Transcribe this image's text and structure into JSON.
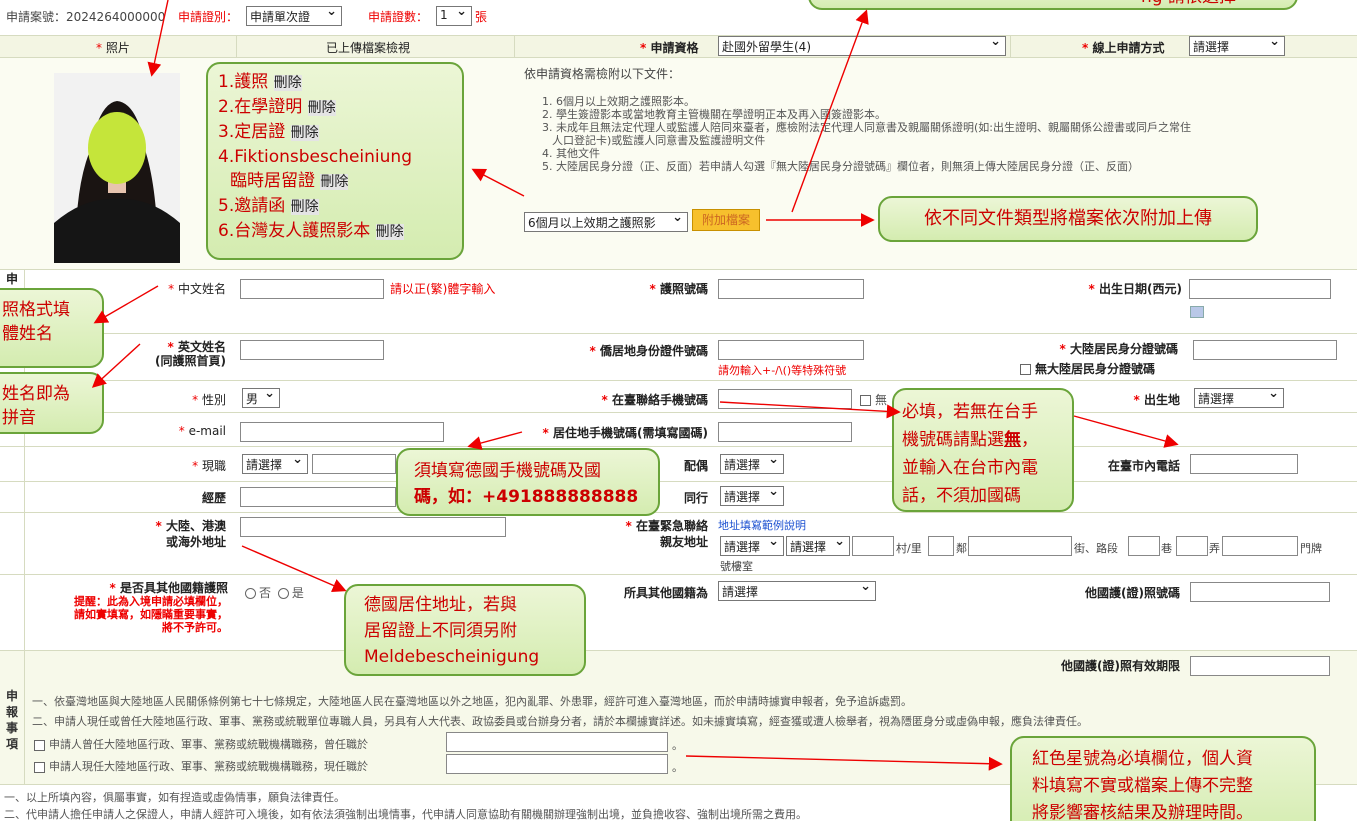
{
  "top": {
    "case_label": "申請案號：",
    "case_no": "2024264000000",
    "cert_type_label": "申請證別：",
    "cert_type_value": "申請單次證",
    "cert_count_label": "申請證數：",
    "cert_count_value": "1",
    "cert_count_unit": "張"
  },
  "header": {
    "photo": "照片",
    "uploaded": "已上傳檔案檢視",
    "qualification": "申請資格",
    "qualification_value": "赴國外留學生(4)",
    "apply_method": "線上申請方式",
    "apply_method_value": "請選擇"
  },
  "docs": {
    "intro": "依申請資格需檢附以下文件：",
    "items": [
      "1. 6個月以上效期之護照影本。",
      "2. 學生簽證影本或當地教育主管機關在學證明正本及再入國簽證影本。",
      "3. 未成年且無法定代理人或監護人陪同來臺者，應檢附法定代理人同意書及親屬關係證明(如:出生證明、親屬關係公證書或同戶之常住",
      "人口登記卡)或監護人同意書及監護證明文件",
      "4. 其他文件",
      "5. 大陸居民身分證（正、反面）若申請人勾選『無大陸居民身分證號碼』欄位者，則無須上傳大陸居民身分證（正、反面）"
    ],
    "select_value": "6個月以上效期之護照影",
    "attach_button": "附加檔案"
  },
  "uploads": [
    {
      "name": "1.護照",
      "del": "刪除"
    },
    {
      "name": "2.在學證明",
      "del": "刪除"
    },
    {
      "name": "3.定居證",
      "del": "刪除"
    },
    {
      "name": "4.Fiktionsbescheiniung",
      "del": ""
    },
    {
      "name": "臨時居留證",
      "del": "刪除"
    },
    {
      "name": "5.邀請函",
      "del": "刪除"
    },
    {
      "name": "6.台灣友人護照影本",
      "del": "刪除"
    }
  ],
  "form": {
    "cn_name": "中文姓名",
    "cn_name_hint": "請以正(繁)體字輸入",
    "passport_no": "護照號碼",
    "birth": "出生日期(西元)",
    "en_name": "英文姓名",
    "en_name_sub": "(同護照首頁)",
    "residence_id": "僑居地身份證件號碼",
    "residence_id_hint": "請勿輸入+-/\\()等特殊符號",
    "mainland_id": "大陸居民身分證號碼",
    "no_mainland_id": "無大陸居民身分證號碼",
    "gender": "性別",
    "gender_value": "男",
    "tw_mobile": "在臺聯絡手機號碼",
    "tw_mobile_none": "無",
    "birthplace": "出生地",
    "birthplace_value": "請選擇",
    "email": "e-mail",
    "res_mobile": "居住地手機號碼(需填寫國碼)",
    "job": "現職",
    "job_value": "請選擇",
    "spouse": "配偶",
    "spouse_value": "請選擇",
    "tw_phone": "在臺市內電話",
    "experience": "經歷",
    "accompany": "同行",
    "accompany_value": "請選擇",
    "address": "大陸、港澳",
    "address2": "或海外地址",
    "emergency": "在臺緊急聯絡",
    "emergency2": "親友地址",
    "addr_example": "地址填寫範例說明",
    "addr_sel1": "請選擇",
    "addr_sel2": "請選擇",
    "addr_village": "村/里",
    "addr_lin": "鄰",
    "addr_street": "街、路段",
    "addr_lane": "巷",
    "addr_alley": "弄",
    "addr_no": "門牌",
    "addr_floor": "號樓室",
    "other_passport": "是否具其他國籍護照",
    "other_passport_note1": "提醒：此為入境申請必填欄位，",
    "other_passport_note2": "請如實填寫，如隱瞞重要事實，",
    "other_passport_note3": "將不予許可。",
    "no": "否",
    "yes": "是",
    "other_nationality": "所具其他國籍為",
    "other_nationality_value": "請選擇",
    "other_passport_no": "他國護(證)照號碼",
    "other_passport_exp": "他國護(證)照有效期限"
  },
  "declare": {
    "title": "申報事項",
    "line1": "一、依臺灣地區與大陸地區人民關係條例第七十七條規定，大陸地區人民在臺灣地區以外之地區，犯內亂罪、外患罪，經許可進入臺灣地區，而於申請時據實申報者，免予追訴處罰。",
    "line2": "二、申請人現任或曾任大陸地區行政、軍事、黨務或統戰單位專職人員，另具有人大代表、政協委員或台辦身分者，請於本欄據實詳述。如未據實填寫，經查獲或遭人檢舉者，視為隱匿身分或虛偽申報，應負法律責任。",
    "chk1": "申請人曾任大陸地區行政、軍事、黨務或統戰機構職務，曾任職於",
    "chk2": "申請人現任大陸地區行政、軍事、黨務或統戰機構職務，現任職於"
  },
  "footer": {
    "line1": "一、以上所填內容，俱屬事實，如有捏造或虛偽情事，願負法律責任。",
    "line2": "二、代申請人擔任申請人之保證人，申請人經許可入境後，如有依法須強制出境情事，代申請人同意協助有關機關辦理強制出境，並負擔收容、強制出境所需之費用。"
  },
  "callouts": {
    "left_top": "照格式填",
    "left_top2": "體姓名",
    "left_bot": "姓名即為",
    "left_bot2": "拼音",
    "attach": "依不同文件類型將檔案依次附加上傳",
    "mobile_de_1": "須填寫德國手機號碼及國",
    "mobile_de_2": "碼，如：+491888888888",
    "tw_mobile_1": "必填，若無在台手",
    "tw_mobile_2": "機號碼請點選",
    "tw_mobile_none": "無",
    "tw_mobile_3": "，",
    "tw_mobile_4": "並輸入在台市內電",
    "tw_mobile_5": "話，不須加國碼",
    "address_1": "德國居住地址，若與",
    "address_2": "居留證上不同須另附",
    "address_3": "Meldebescheinigung",
    "required_1": "紅色星號為必填欄位，個人資",
    "required_2": "料填寫不實或檔案上傳不完整",
    "required_3": "將影響審核結果及辦理時間。",
    "top_partial": "ng 請依選擇"
  },
  "side_label": "申"
}
